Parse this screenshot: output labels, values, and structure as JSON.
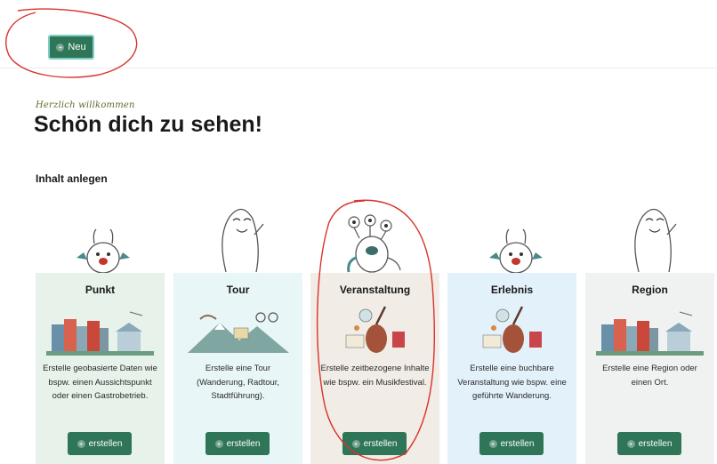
{
  "header": {
    "new_button_label": "Neu"
  },
  "greeting": {
    "subtitle": "Herzlich willkommen",
    "title": "Schön dich zu sehen!"
  },
  "section": {
    "label": "Inhalt anlegen"
  },
  "cards": [
    {
      "title": "Punkt",
      "description": "Erstelle geobasierte Daten wie bspw. einen Aussichtspunkt oder einen Gastrobetrieb.",
      "button": "erstellen",
      "color": "#e6f2ea"
    },
    {
      "title": "Tour",
      "description": "Erstelle eine Tour (Wanderung, Radtour, Stadtführung).",
      "button": "erstellen",
      "color": "#e9f6f7"
    },
    {
      "title": "Veranstaltung",
      "description": "Erstelle zeitbezogene Inhalte wie bspw. ein Musikfestival.",
      "button": "erstellen",
      "color": "#f1ece6"
    },
    {
      "title": "Erlebnis",
      "description": "Erstelle eine buchbare Veranstaltung wie bspw. eine geführte Wanderung.",
      "button": "erstellen",
      "color": "#e3f1fa"
    },
    {
      "title": "Region",
      "description": "Erstelle eine Region oder einen Ort.",
      "button": "erstellen",
      "color": "#f0f2f2"
    }
  ],
  "colors": {
    "primary_button": "#2f7557",
    "annotation": "#d8332b"
  }
}
